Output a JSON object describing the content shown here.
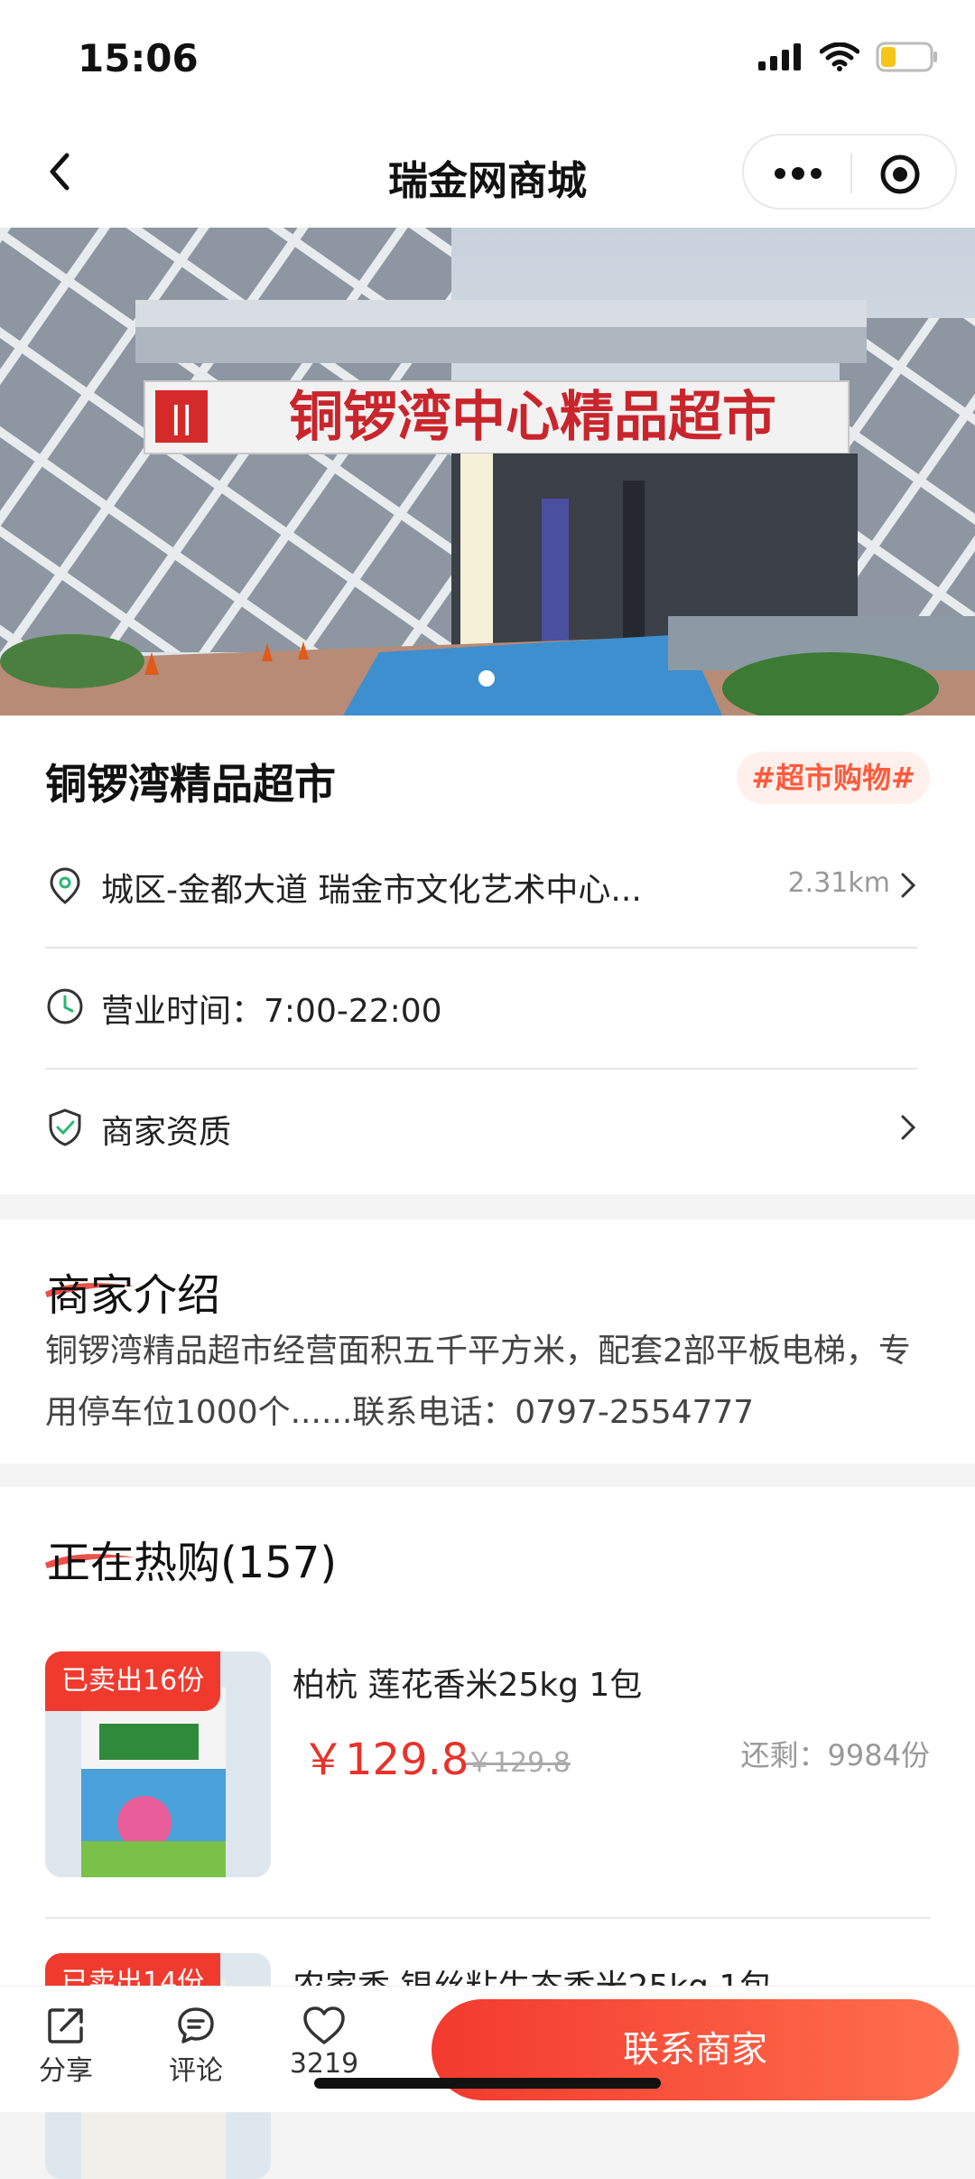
{
  "status_bar": {
    "time": "15:06"
  },
  "navbar": {
    "title": "瑞金网商城"
  },
  "banner": {
    "sign_text": "铜锣湾中心精品超市"
  },
  "shop": {
    "name": "铜锣湾精品超市",
    "tag": "#超市购物#",
    "address": "城区-金都大道 瑞金市文化艺术中心...",
    "distance": "2.31km",
    "hours": "营业时间：7:00-22:00",
    "qualification": "商家资质"
  },
  "intro": {
    "title": "商家介绍",
    "text": "铜锣湾精品超市经营面积五千平方米，配套2部平板电梯，专用停车位1000个......联系电话：0797-2554777"
  },
  "hot": {
    "title": "正在热购(157)",
    "products": [
      {
        "sold": "已卖出16份",
        "name": "柏杭 莲花香米25kg 1包",
        "price": "￥129.8",
        "original_price": "￥129.8",
        "remaining": "还剩：9984份"
      },
      {
        "sold": "已卖出14份",
        "name": "农家香 银丝粘生态香米25kg 1包"
      }
    ]
  },
  "bottom_bar": {
    "share": "分享",
    "comment": "评论",
    "like_count": "3219",
    "contact_button": "联系商家"
  }
}
